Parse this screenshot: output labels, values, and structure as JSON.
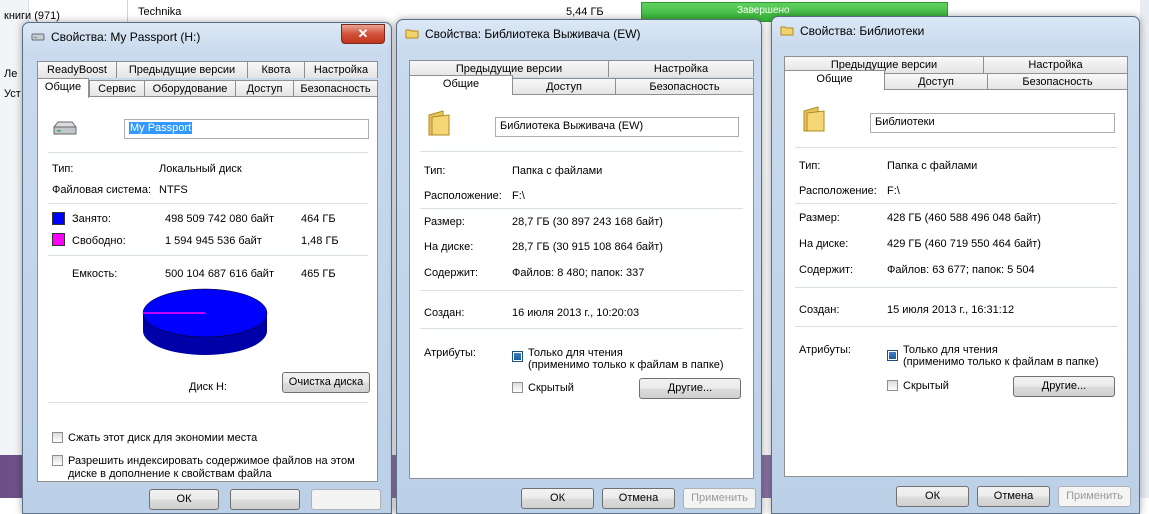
{
  "background": {
    "items": [
      "книги (971)",
      "Ле",
      "Уст"
    ],
    "row_name": "Technika",
    "row_size": "5,44 ГБ",
    "row_status": "Завершено"
  },
  "win1": {
    "title": "Свойства: My Passport (H:)",
    "tabs_row1": [
      "ReadyBoost",
      "Предыдущие версии",
      "Квота",
      "Настройка"
    ],
    "tabs_row2": [
      "Общие",
      "Сервис",
      "Оборудование",
      "Доступ",
      "Безопасность"
    ],
    "name_value": "My Passport",
    "type_label": "Тип:",
    "type_value": "Локальный диск",
    "fs_label": "Файловая система:",
    "fs_value": "NTFS",
    "used_label": "Занято:",
    "used_bytes": "498 509 742 080 байт",
    "used_gb": "464 ГБ",
    "free_label": "Свободно:",
    "free_bytes": "1 594 945 536 байт",
    "free_gb": "1,48 ГБ",
    "cap_label": "Емкость:",
    "cap_bytes": "500 104 687 616 байт",
    "cap_gb": "465 ГБ",
    "disk_label": "Диск H:",
    "cleanup_button": "Очистка диска",
    "compress_label": "Сжать этот диск для экономии места",
    "index_label_1": "Разрешить индексировать содержимое файлов на этом",
    "index_label_2": "диске в дополнение к свойствам файла",
    "ok": "ОК",
    "colors": {
      "used": "#0000ff",
      "free": "#ff00ff"
    },
    "used_fraction": 0.9968
  },
  "win2": {
    "title": "Свойства: Библиотека Выживача (EW)",
    "tabs_row1": [
      "Предыдущие версии",
      "Настройка"
    ],
    "tabs_row2": [
      "Общие",
      "Доступ",
      "Безопасность"
    ],
    "name_value": "Библиотека Выживача (EW)",
    "type_label": "Тип:",
    "type_value": "Папка с файлами",
    "loc_label": "Расположение:",
    "loc_value": "F:\\",
    "size_label": "Размер:",
    "size_value": "28,7 ГБ (30 897 243 168 байт)",
    "disk_label": "На диске:",
    "disk_value": "28,7 ГБ (30 915 108 864 байт)",
    "contains_label": "Содержит:",
    "contains_value": "Файлов: 8 480; папок: 337",
    "created_label": "Создан:",
    "created_value": "16 июля 2013 г., 10:20:03",
    "attr_label": "Атрибуты:",
    "readonly_label_1": "Только для чтения",
    "readonly_label_2": "(применимо только к файлам в папке)",
    "hidden_label": "Скрытый",
    "other_button": "Другие...",
    "ok": "ОК",
    "cancel": "Отмена",
    "apply": "Применить"
  },
  "win3": {
    "title": "Свойства: Библиотеки",
    "tabs_row1": [
      "Предыдущие версии",
      "Настройка"
    ],
    "tabs_row2": [
      "Общие",
      "Доступ",
      "Безопасность"
    ],
    "name_value": "Библиотеки",
    "type_label": "Тип:",
    "type_value": "Папка с файлами",
    "loc_label": "Расположение:",
    "loc_value": "F:\\",
    "size_label": "Размер:",
    "size_value": "428 ГБ (460 588 496 048 байт)",
    "disk_label": "На диске:",
    "disk_value": "429 ГБ (460 719 550 464 байт)",
    "contains_label": "Содержит:",
    "contains_value": "Файлов: 63 677; папок: 5 504",
    "created_label": "Создан:",
    "created_value": "15 июля 2013 г., 16:31:12",
    "attr_label": "Атрибуты:",
    "readonly_label_1": "Только для чтения",
    "readonly_label_2": "(применимо только к файлам в папке)",
    "hidden_label": "Скрытый",
    "other_button": "Другие...",
    "ok": "ОК",
    "cancel": "Отмена",
    "apply": "Применить"
  },
  "icons": {
    "close": "close-icon",
    "drive": "drive-icon",
    "folder": "folder-icon"
  }
}
